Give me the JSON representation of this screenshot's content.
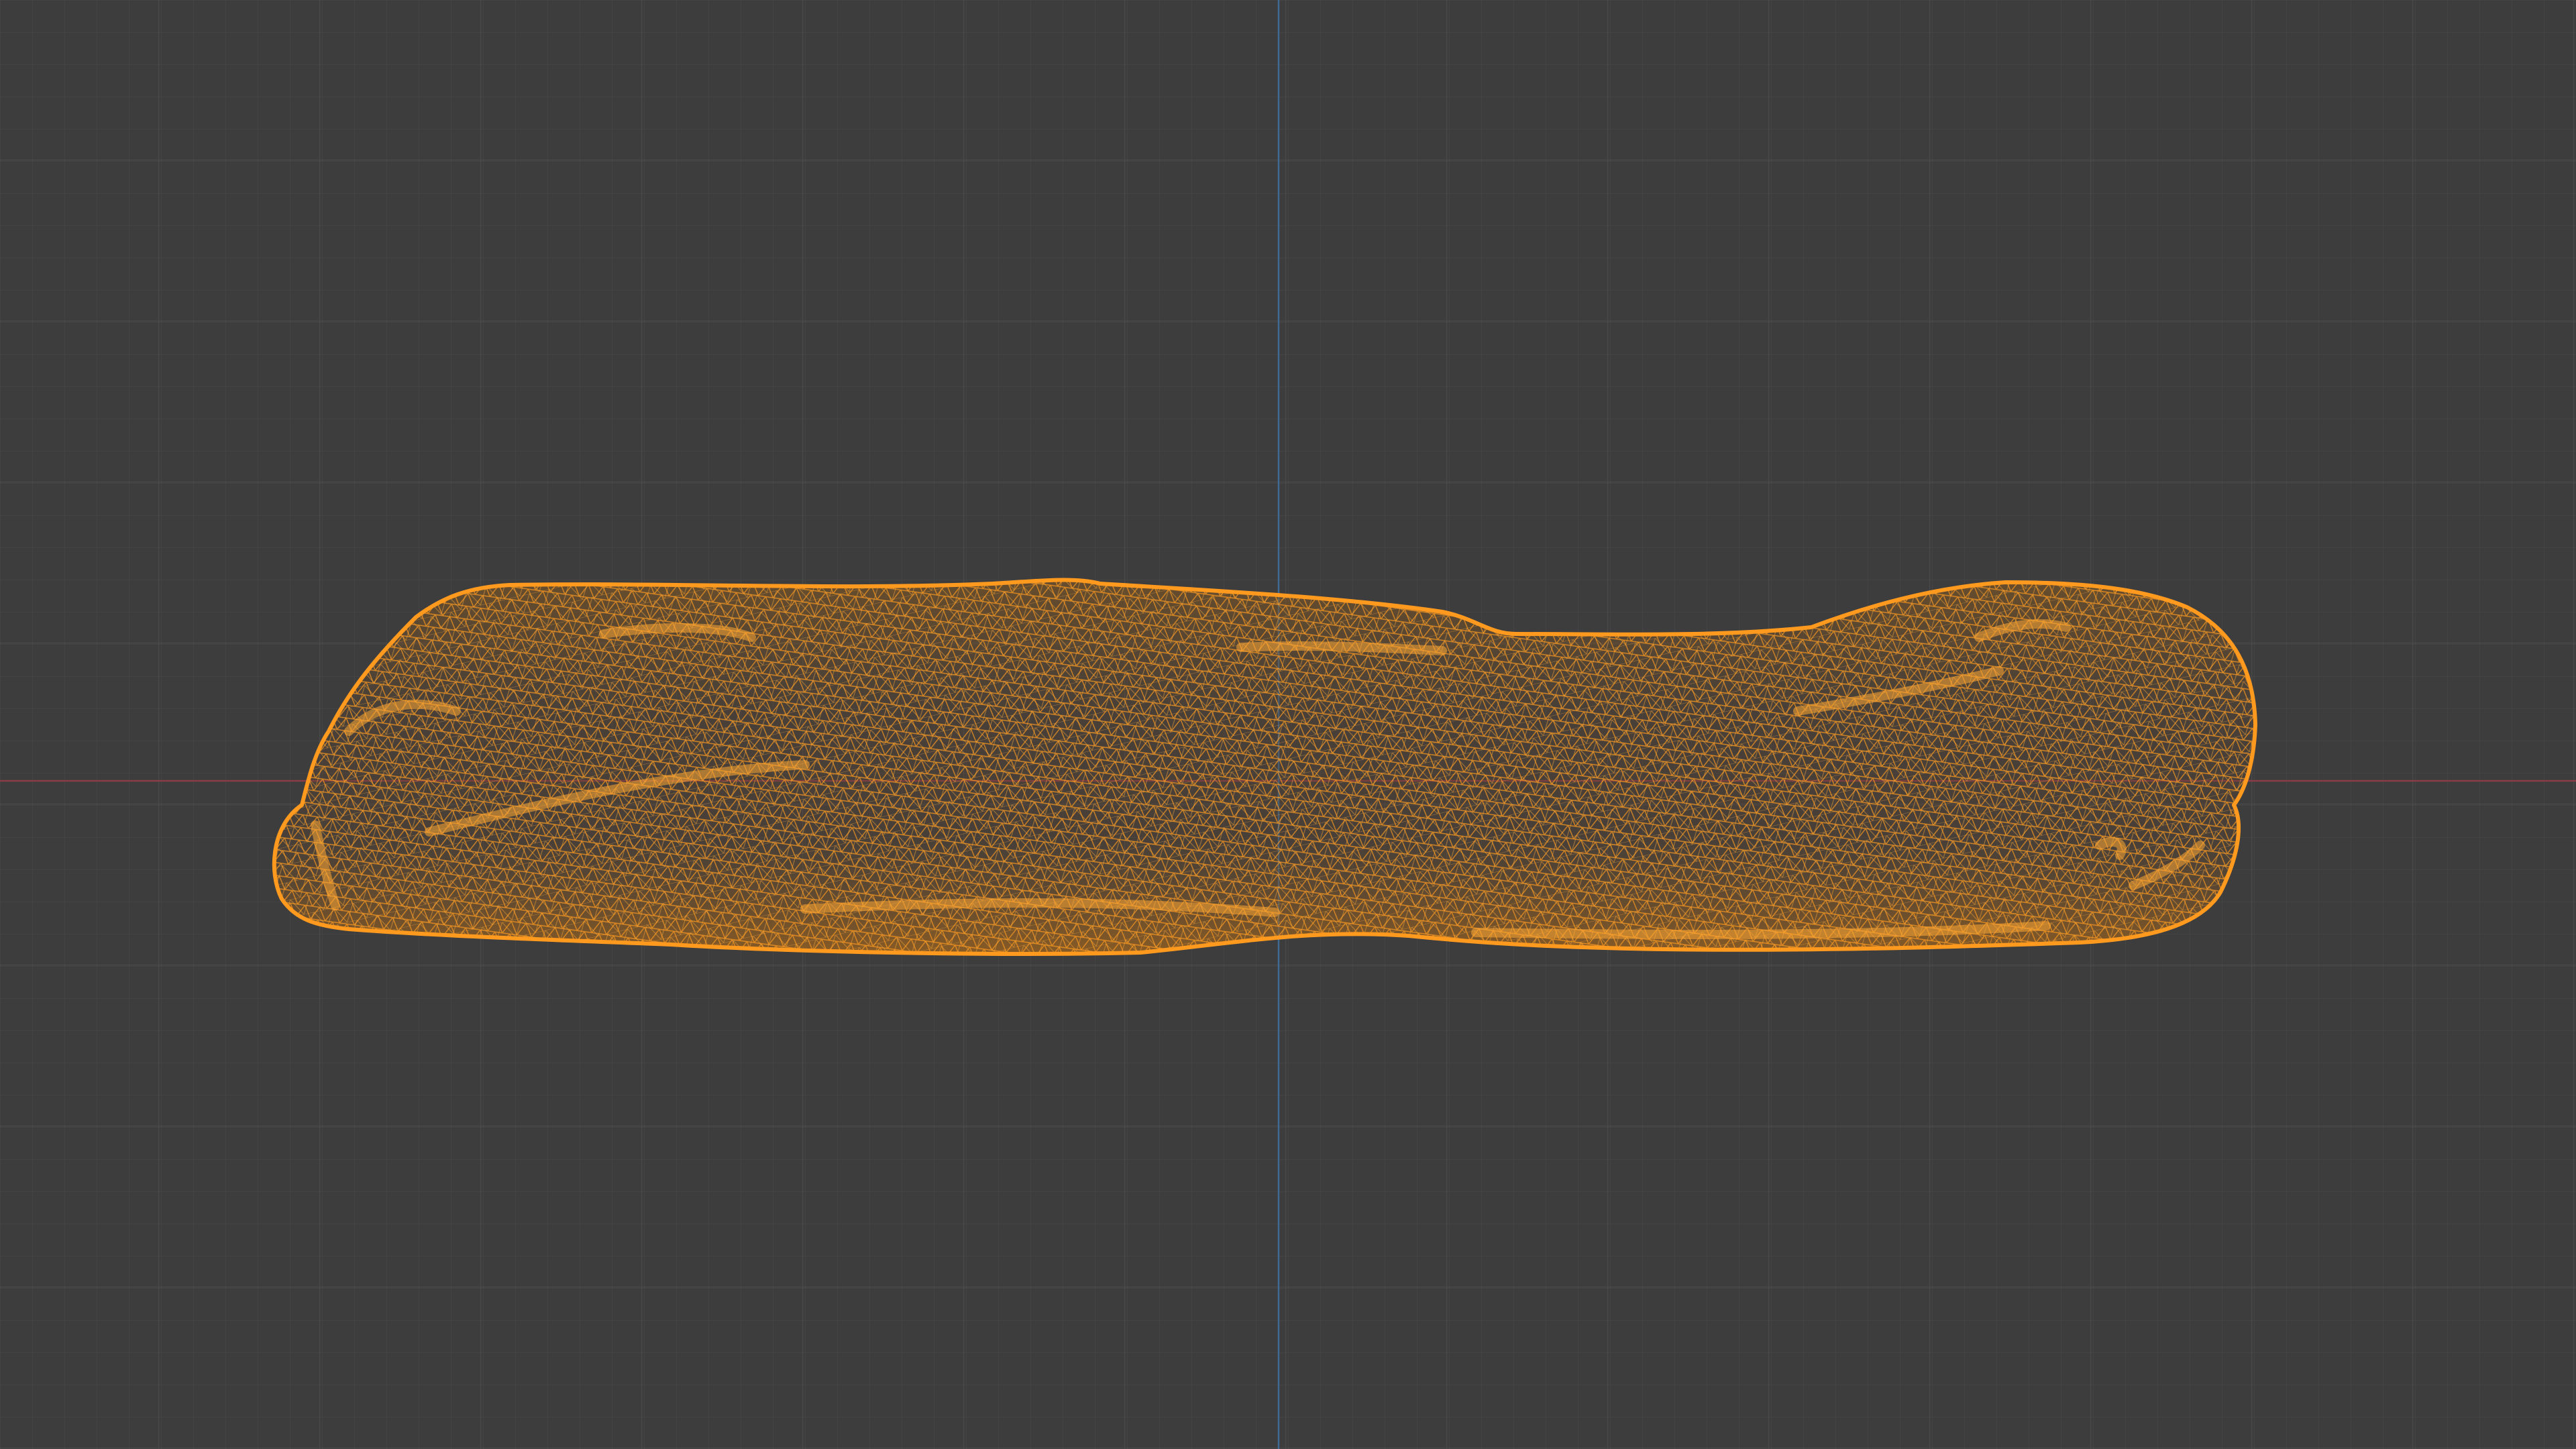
{
  "viewport": {
    "mode": "wireframe",
    "object": "mesh-object",
    "colors": {
      "background": "#3d3d3d",
      "grid_minor": "#454545",
      "grid_major": "#4c4c4c",
      "x_axis": "#8a3d47",
      "z_axis": "#3f6a94",
      "wire": "#ff9a1f",
      "wire_dark": "#b86a10",
      "fill": "#5a4430"
    }
  }
}
